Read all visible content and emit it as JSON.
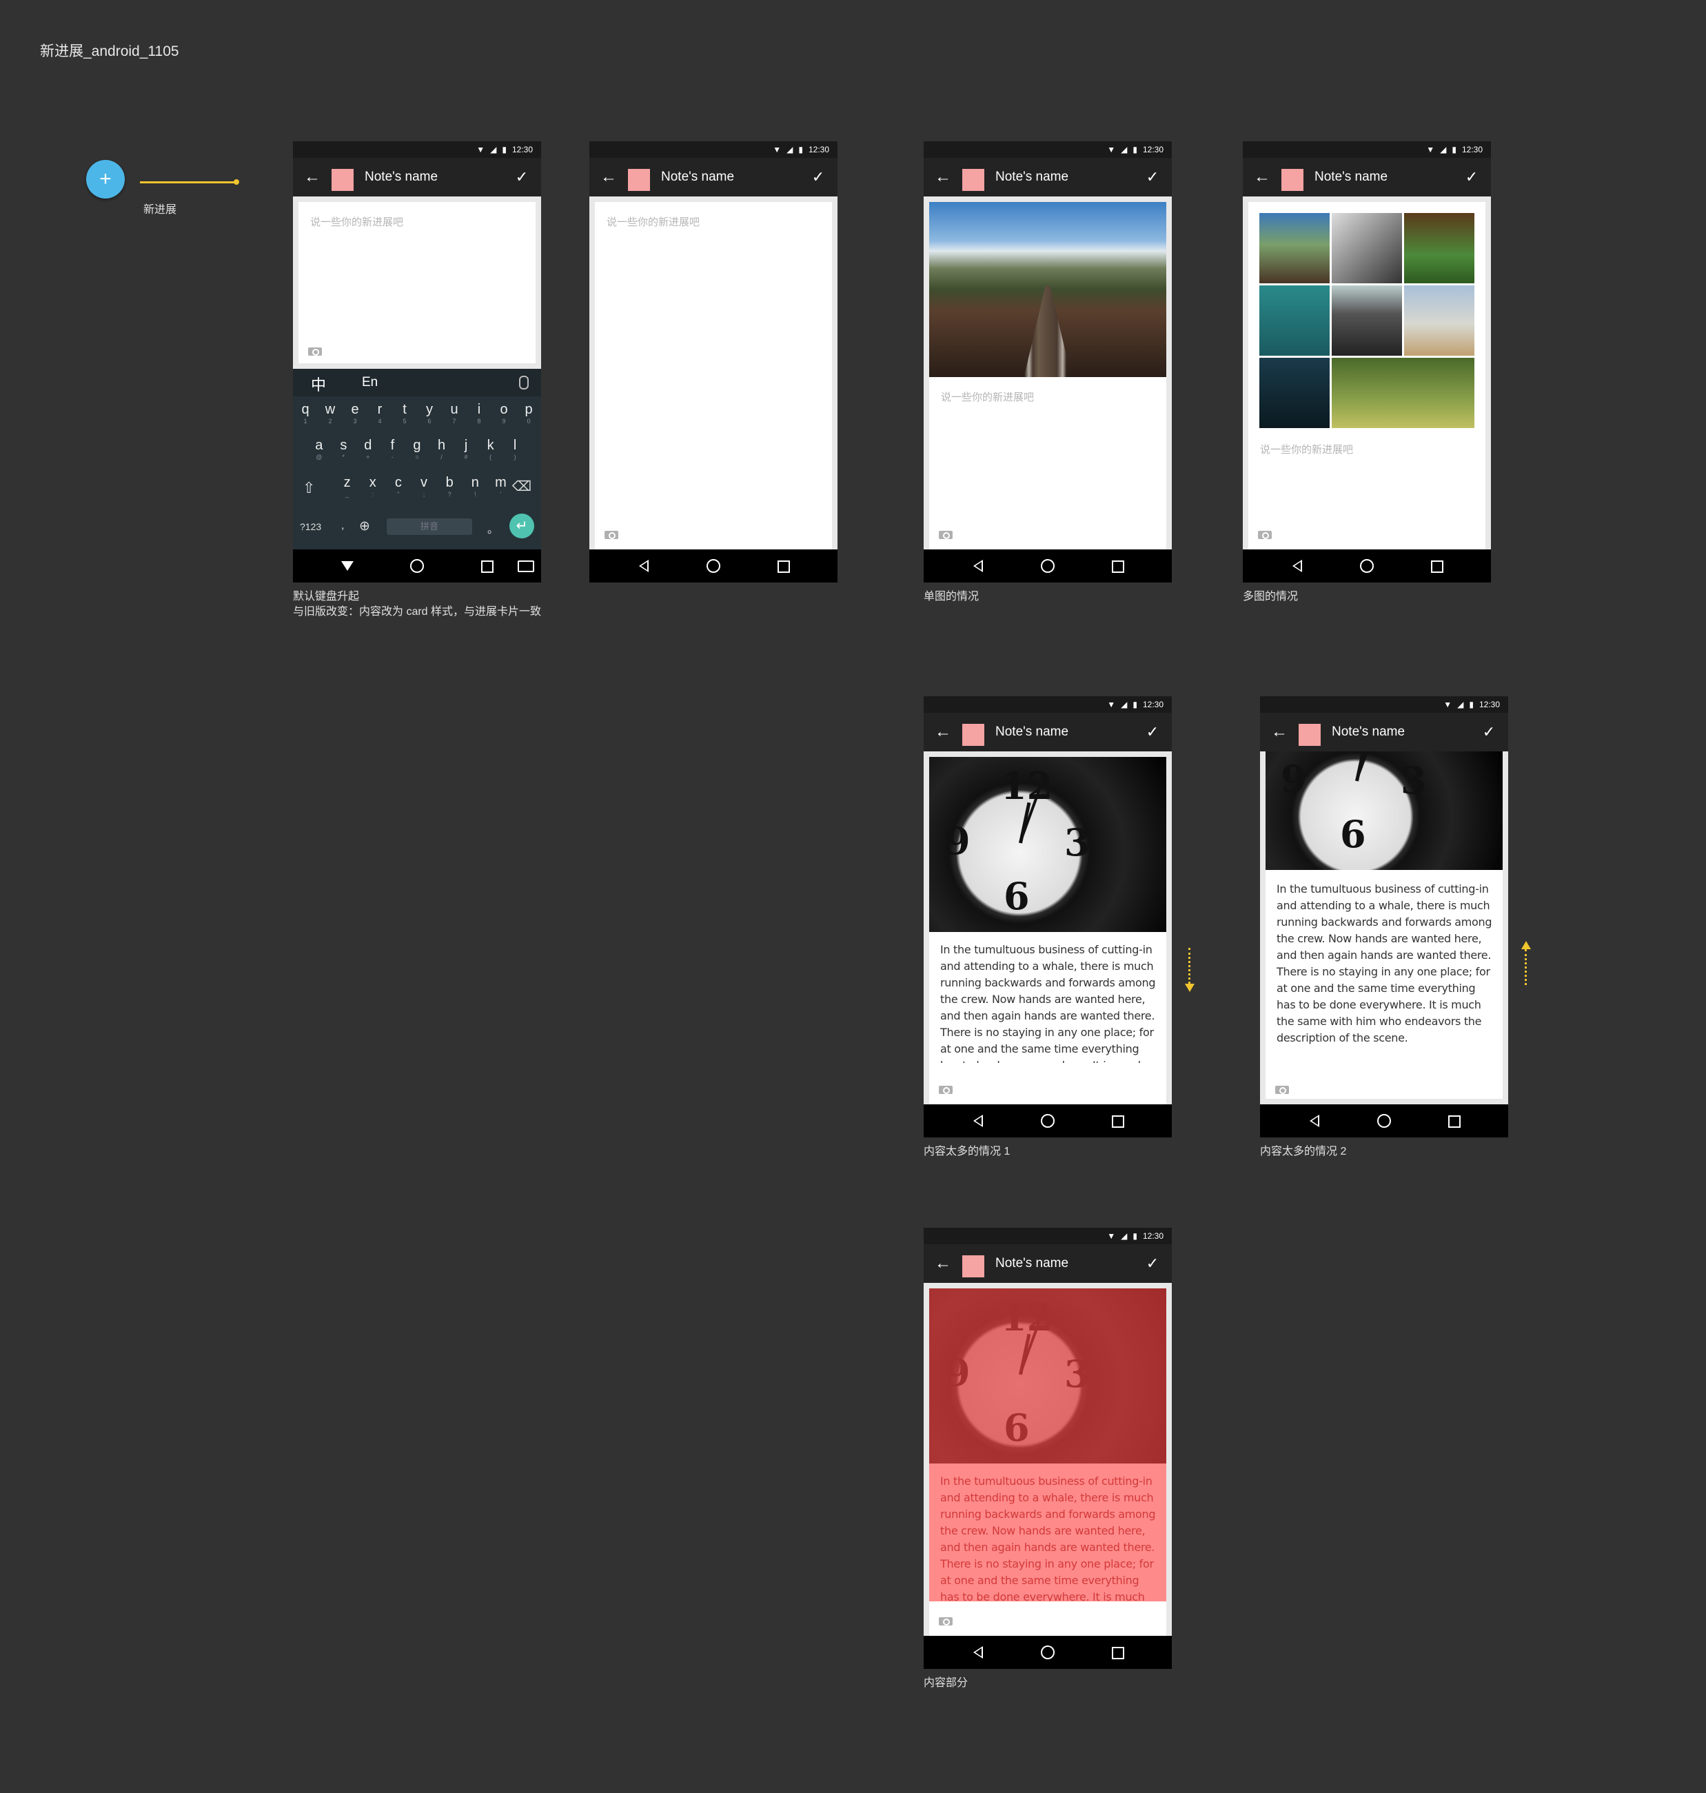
{
  "page": {
    "title": "新进展_android_1105"
  },
  "fab": {
    "icon": "+",
    "label": "新进展"
  },
  "common": {
    "time": "12:30",
    "note_name": "Note's name",
    "placeholder": "说一些你的新进展吧",
    "body_text": "In the tumultuous business of cutting-in and attending to a whale, there is much running backwards and forwards among the crew. Now hands are wanted here, and then again hands are wanted there. There is no staying in any one place; for at one and the same time everything has to be done everywhere. It is much the same with him who endeavors the description of the scene."
  },
  "keyboard": {
    "zh": "中",
    "en": "En",
    "row1": [
      "q",
      "w",
      "e",
      "r",
      "t",
      "y",
      "u",
      "i",
      "o",
      "p"
    ],
    "row1_sub": [
      "1",
      "2",
      "3",
      "4",
      "5",
      "6",
      "7",
      "8",
      "9",
      "0"
    ],
    "row2": [
      "a",
      "s",
      "d",
      "f",
      "g",
      "h",
      "j",
      "k",
      "l"
    ],
    "row2_sub": [
      "@",
      "*",
      "+",
      "-",
      "=",
      "/",
      "#",
      "(",
      ")"
    ],
    "row3": [
      "z",
      "x",
      "c",
      "v",
      "b",
      "n",
      "m"
    ],
    "row3_sub": [
      "_",
      ":",
      "\"",
      ";",
      "?",
      "!",
      "'"
    ],
    "symbols": "?123",
    "comma": ",",
    "space": "拼音",
    "period": "。"
  },
  "captions": {
    "screen1_line1": "默认键盘升起",
    "screen1_line2": "与旧版改变：内容改为 card 样式，与进展卡片一致",
    "screen3": "单图的情况",
    "screen4": "多图的情况",
    "screen5": "内容太多的情况 1",
    "screen6": "内容太多的情况 2",
    "screen7": "内容部分"
  },
  "colors": {
    "background": "#323232",
    "fab": "#4db6e8",
    "accent_arrow": "#f0c52e",
    "swatch": "#f5a3a3",
    "highlight_image": "#e13c3c",
    "highlight_text": "#ff8a8a"
  },
  "icons": [
    "back-arrow-icon",
    "check-icon",
    "camera-icon",
    "wifi-icon",
    "signal-icon",
    "battery-icon",
    "nav-back-icon",
    "nav-home-icon",
    "nav-recent-icon",
    "mic-icon",
    "globe-icon",
    "shift-icon",
    "backspace-icon",
    "enter-icon",
    "keyboard-icon"
  ]
}
